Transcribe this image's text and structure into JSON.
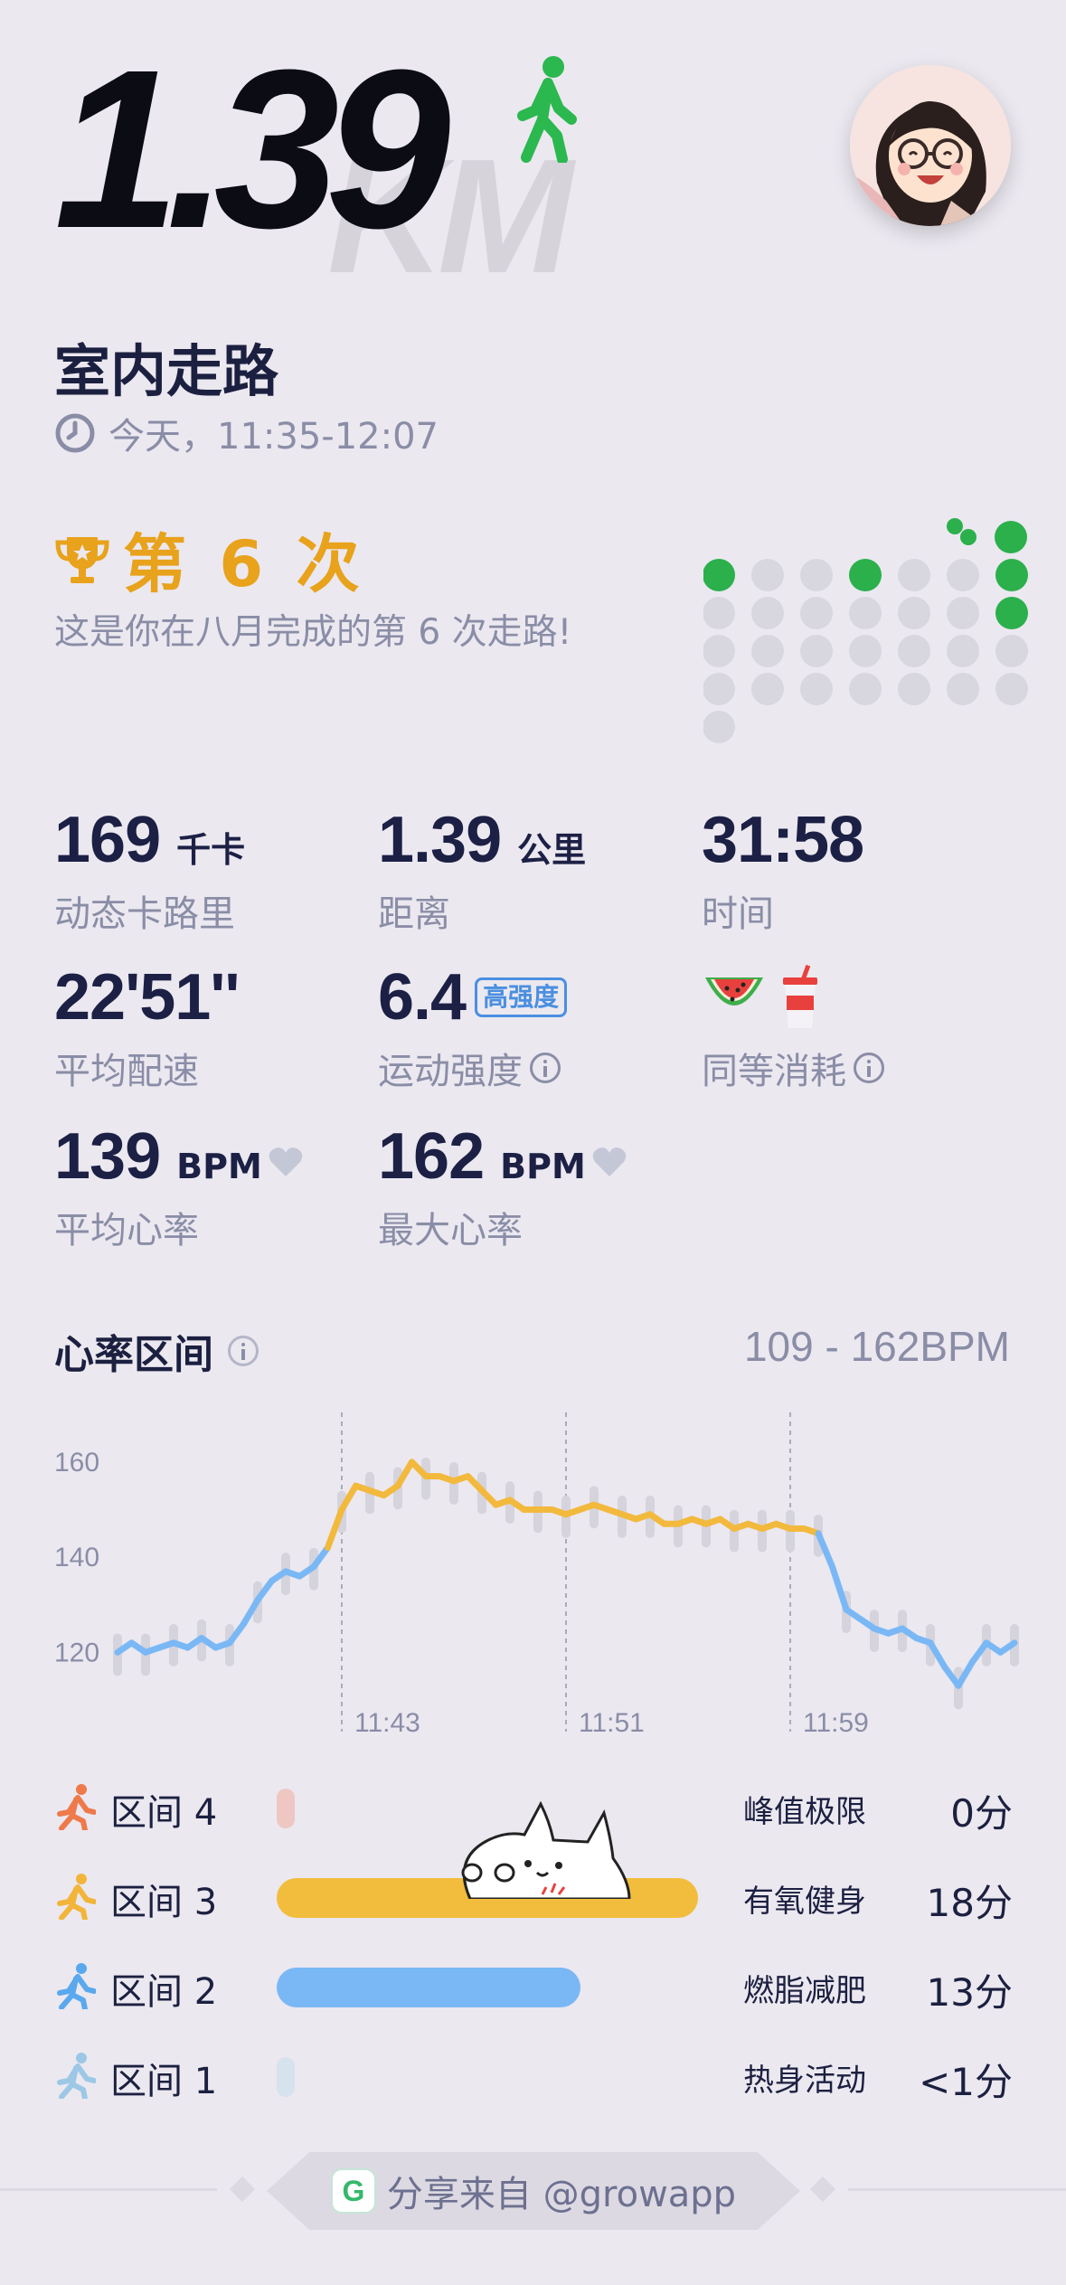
{
  "hero": {
    "distance": "1.39",
    "unit_watermark": "KM"
  },
  "activity": {
    "title": "室内走路",
    "time": "今天，11:35-12:07"
  },
  "milestone": {
    "count_label": "第 6 次",
    "description": "这是你在八月完成的第 6 次走路!"
  },
  "stats": {
    "calories": {
      "value": "169",
      "unit": "千卡",
      "label": "动态卡路里"
    },
    "distance": {
      "value": "1.39",
      "unit": "公里",
      "label": "距离"
    },
    "duration": {
      "value": "31:58",
      "label": "时间"
    },
    "pace": {
      "value": "22'51''",
      "label": "平均配速"
    },
    "intensity": {
      "value": "6.4",
      "badge": "高强度",
      "label": "运动强度"
    },
    "equivalent": {
      "label": "同等消耗",
      "icons": [
        "watermelon-icon",
        "drink-cup-icon"
      ]
    },
    "avg_hr": {
      "value": "139",
      "unit": "BPM",
      "label": "平均心率"
    },
    "max_hr": {
      "value": "162",
      "unit": "BPM",
      "label": "最大心率"
    }
  },
  "heart_zone": {
    "title": "心率区间",
    "range": "109 - 162BPM"
  },
  "chart_data": {
    "type": "line",
    "title": "",
    "ylim": [
      110,
      167
    ],
    "y_ticks": [
      160,
      140,
      120
    ],
    "x_ticks": [
      "11:43",
      "11:51",
      "11:59"
    ],
    "x_tick_minutes": [
      8,
      16,
      24
    ],
    "x_range_minutes": [
      0,
      32
    ],
    "grid": false,
    "series": [
      {
        "x": [
          0,
          0.5,
          1,
          1.5,
          2,
          2.5,
          3,
          3.5,
          4,
          4.5,
          5,
          5.5,
          6,
          6.5,
          7,
          7.5,
          8,
          8.5,
          9,
          9.5,
          10,
          10.5,
          11,
          11.5,
          12,
          12.5,
          13,
          13.5,
          14,
          14.5,
          15,
          15.5,
          16,
          16.5,
          17,
          17.5,
          18,
          18.5,
          19,
          19.5,
          20,
          20.5,
          21,
          21.5,
          22,
          22.5,
          23,
          23.5,
          24,
          24.5,
          25,
          25.5,
          26,
          26.5,
          27,
          27.5,
          28,
          28.5,
          29,
          29.5,
          30,
          30.5,
          31,
          31.5,
          32
        ],
        "y": [
          120,
          122,
          120,
          121,
          122,
          121,
          123,
          121,
          122,
          126,
          131,
          135,
          137,
          136,
          138,
          142,
          150,
          155,
          154,
          153,
          155,
          160,
          157,
          157,
          156,
          157,
          154,
          151,
          152,
          150,
          150,
          150,
          149,
          150,
          151,
          150,
          149,
          148,
          149,
          147,
          147,
          148,
          147,
          148,
          146,
          147,
          146,
          147,
          146,
          146,
          145,
          138,
          129,
          127,
          125,
          124,
          125,
          123,
          122,
          117,
          113,
          118,
          122,
          120,
          122
        ]
      }
    ],
    "colors": {
      "zone3": "#f2b93c",
      "zone2": "#7ab8f5"
    }
  },
  "zones": [
    {
      "label": "区间 4",
      "name": "峰值极限",
      "minutes": "0分",
      "fraction": 0.0,
      "color": "#eec7c3",
      "icon": "runner-sprint-icon",
      "icon_color": "#ee7a4b"
    },
    {
      "label": "区间 3",
      "name": "有氧健身",
      "minutes": "18分",
      "fraction": 1.0,
      "color": "#f2bd3c",
      "icon": "runner-icon",
      "icon_color": "#f2b53a"
    },
    {
      "label": "区间 2",
      "name": "燃脂减肥",
      "minutes": "13分",
      "fraction": 0.72,
      "color": "#7ab8f5",
      "icon": "jogger-icon",
      "icon_color": "#5aa8ee"
    },
    {
      "label": "区间 1",
      "name": "热身活动",
      "minutes": "<1分",
      "fraction": 0.0,
      "color": "#d6e3ee",
      "icon": "stretch-icon",
      "icon_color": "#9cc8e6"
    }
  ],
  "footer": {
    "text": "分享来自 @growapp",
    "logo": "G"
  }
}
